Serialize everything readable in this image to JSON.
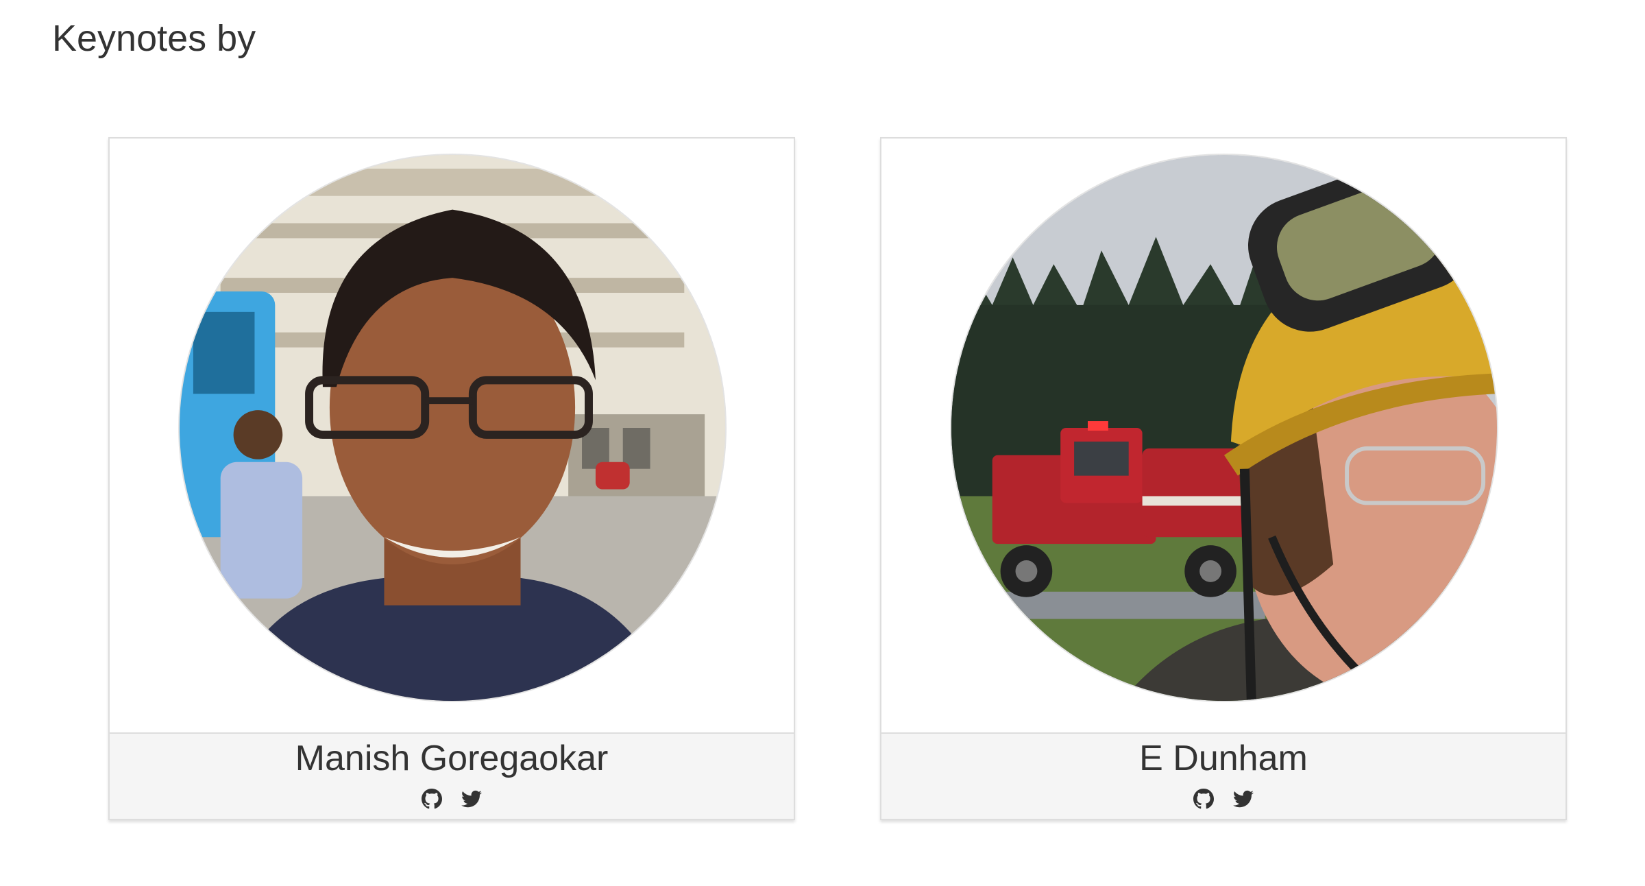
{
  "section": {
    "title": "Keynotes by"
  },
  "speakers": [
    {
      "name": "Manish Goregaokar",
      "photo": "portrait-photo",
      "links": [
        "github-icon",
        "twitter-icon"
      ]
    },
    {
      "name": "E Dunham",
      "photo": "portrait-photo",
      "links": [
        "github-icon",
        "twitter-icon"
      ]
    }
  ],
  "colors": {
    "text": "#333333",
    "card_border": "#dddddd",
    "footer_bg": "#f5f5f5",
    "icon": "#333333"
  }
}
